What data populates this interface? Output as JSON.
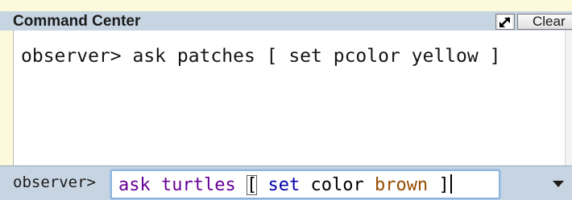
{
  "panel": {
    "title": "Command Center",
    "clear_label": "Clear",
    "expand_icon": "expand-icon"
  },
  "history": {
    "lines": [
      "observer> ask patches [ set pcolor yellow ]"
    ]
  },
  "input": {
    "prompt": "observer>",
    "tokens": [
      {
        "text": "ask",
        "kind": "primitive"
      },
      {
        "text": " "
      },
      {
        "text": "turtles",
        "kind": "primitive"
      },
      {
        "text": " "
      },
      {
        "text": "[",
        "kind": "bracket"
      },
      {
        "text": " "
      },
      {
        "text": "set",
        "kind": "keyword"
      },
      {
        "text": " "
      },
      {
        "text": "color",
        "kind": "var"
      },
      {
        "text": " "
      },
      {
        "text": "brown",
        "kind": "const"
      },
      {
        "text": " "
      },
      {
        "text": "]",
        "kind": "bracket"
      }
    ],
    "dropdown_icon": "chevron-down-icon"
  },
  "colors": {
    "header_bg": "#c7d4e2",
    "page_bg": "#fdf9dc",
    "primitive": "#660096",
    "keyword": "#0000aa",
    "constant": "#964b00",
    "input_focus_border": "#8ab3df"
  }
}
